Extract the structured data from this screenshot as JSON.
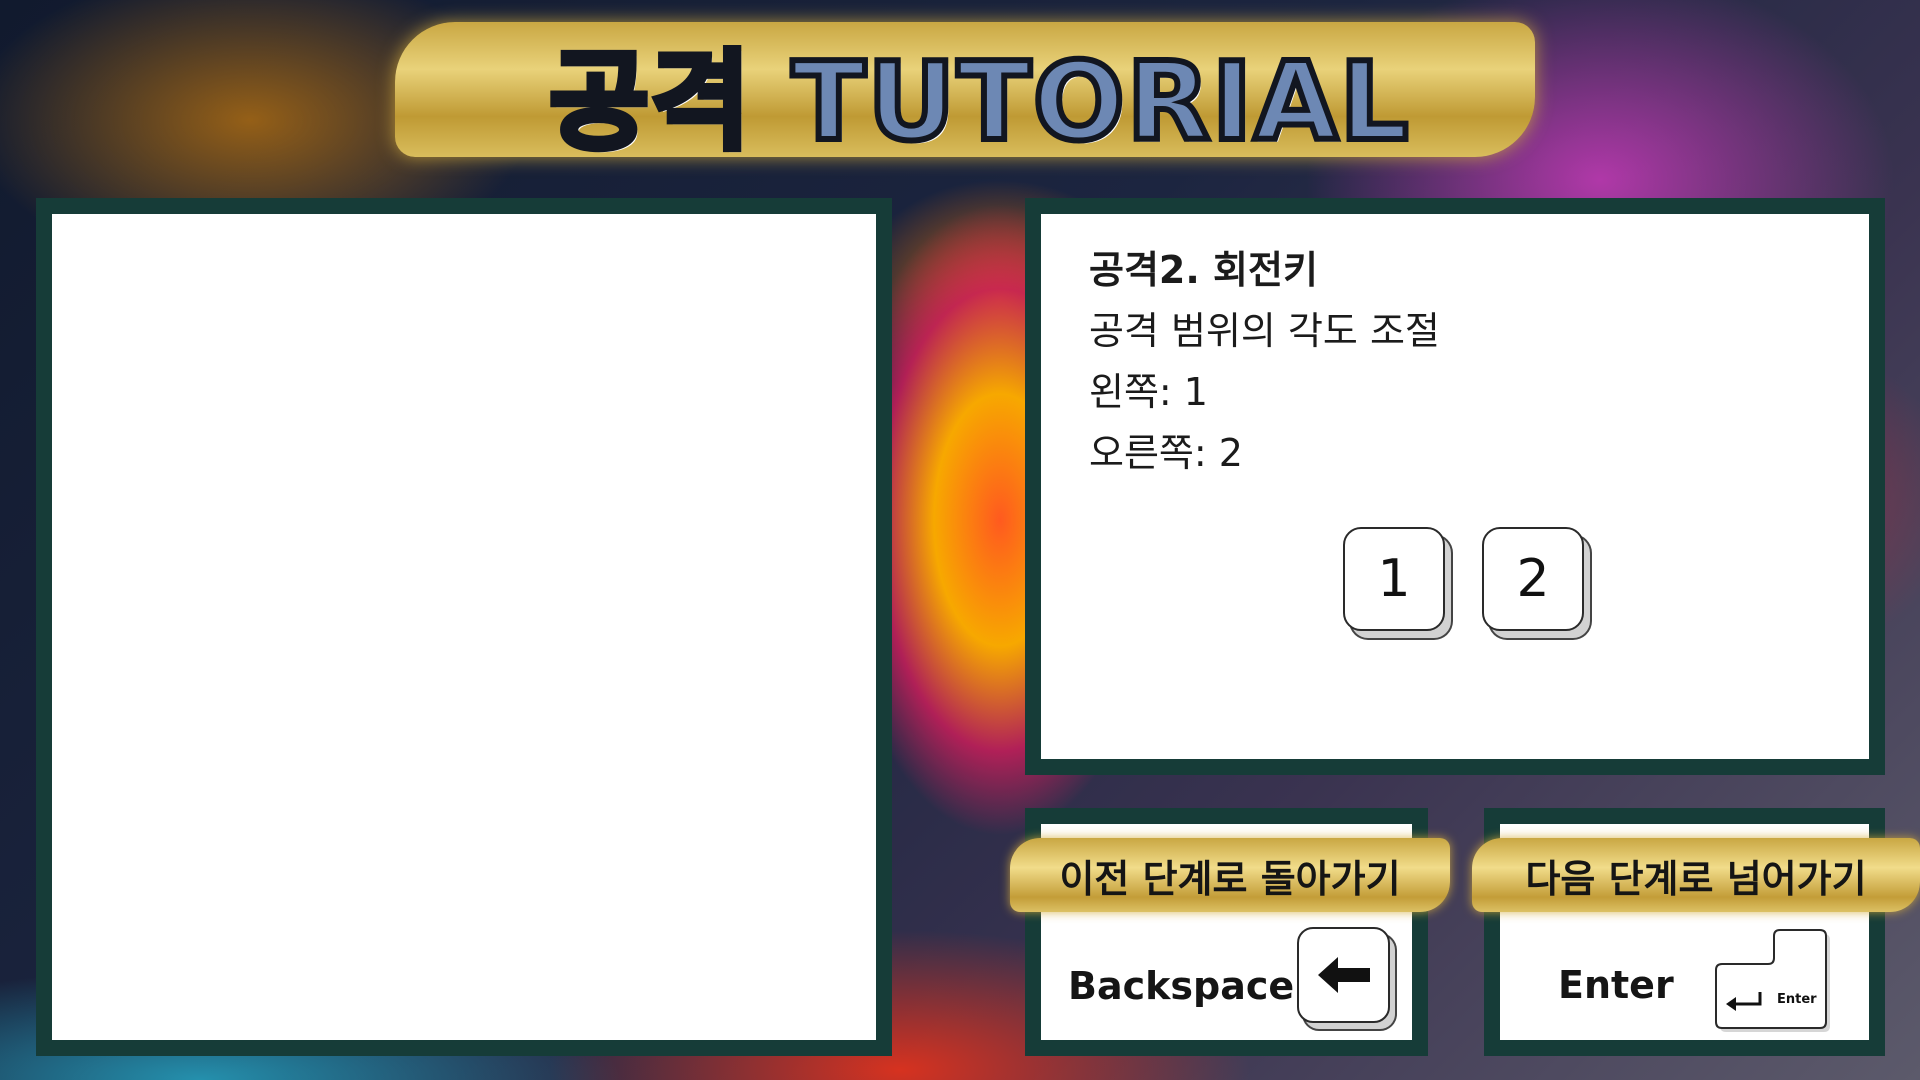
{
  "title": "공격 TUTORIAL",
  "info": {
    "heading": "공격2. 회전키",
    "description": "공격 범위의 각도 조절",
    "left_line": "왼쪽: 1",
    "right_line": "오른쪽: 2"
  },
  "keys": [
    "1",
    "2"
  ],
  "back": {
    "label": "이전 단계로 돌아가기",
    "key_name": "Backspace",
    "icon": "left-arrow-icon"
  },
  "next": {
    "label": "다음 단계로 넘어가기",
    "key_name": "Enter",
    "key_cap_label": "Enter",
    "icon": "enter-return-icon"
  },
  "colors": {
    "panel_border": "#163c38",
    "gold": "#d9bd5c",
    "title_fill": "#6d88b4"
  }
}
